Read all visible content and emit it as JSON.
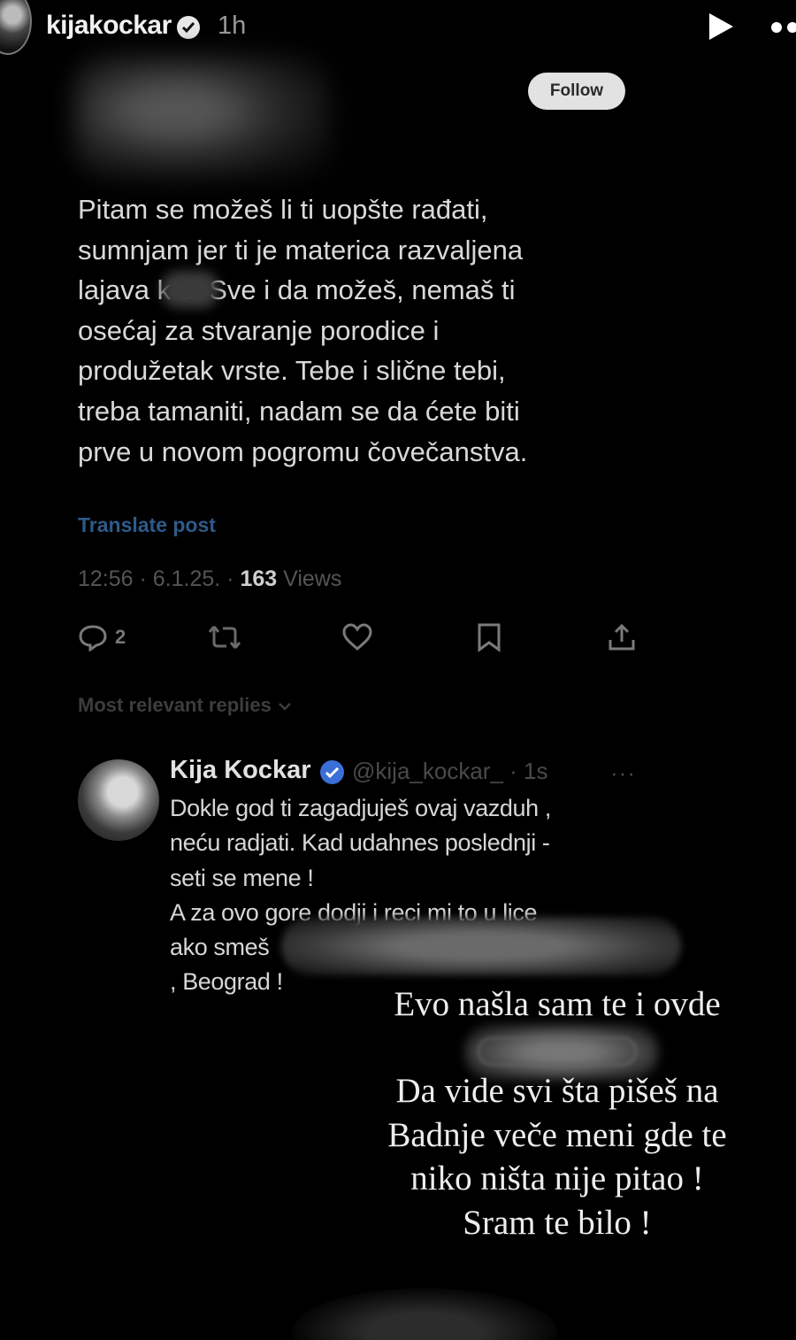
{
  "story": {
    "username": "kijakockar",
    "time": "1h"
  },
  "tweet": {
    "follow_label": "Follow",
    "lines": [
      "Pitam se možeš li ti uopšte rađati,",
      "sumnjam jer ti je materica razvaljena",
      "lajava k      o. Sve i da možeš, nemaš ti",
      "osećaj za stvaranje porodice i",
      "produžetak vrste. Tebe i slične tebi,",
      "treba tamaniti, nadam se da ćete biti",
      "prve u novom pogromu čovečanstva."
    ],
    "translate_label": "Translate post",
    "meta_time": "12:56 · 6.1.25. · ",
    "views_count": "163",
    "views_label": " Views",
    "reply_count": "2",
    "most_relevant_label": "Most relevant replies"
  },
  "reply": {
    "name": "Kija Kockar",
    "handle": "@kija_kockar_ · 1s",
    "more": "···",
    "lines": [
      "Dokle god ti zagadjuješ ovaj vazduh ,",
      "neću radjati. Kad udahnes poslednji -",
      "seti se mene !",
      "A za ovo gore dodji i reci mi to u lice",
      "ako smeš",
      ", Beograd !"
    ]
  },
  "overlay": {
    "line1": "Evo našla sam te i ovde",
    "lines": [
      "Da vide svi šta pišeš na",
      "Badnje veče meni gde te",
      "niko ništa nije pitao !",
      "Sram te bilo !"
    ]
  }
}
